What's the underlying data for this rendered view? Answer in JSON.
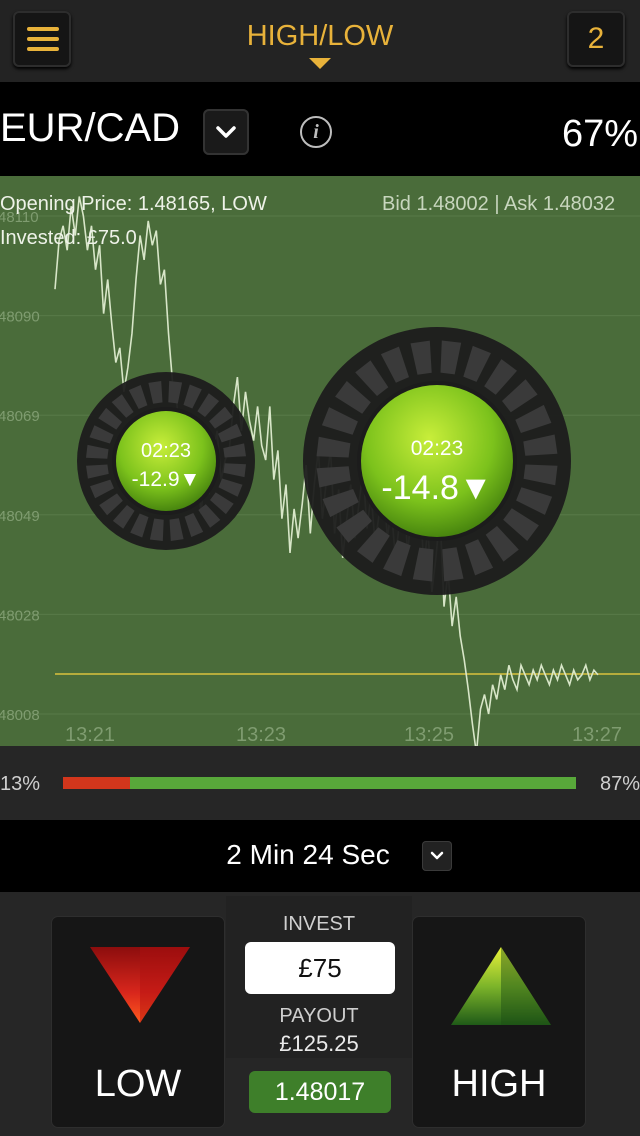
{
  "header": {
    "title": "HIGH/LOW",
    "count": "2"
  },
  "asset": {
    "name": "EUR/CAD",
    "payout_percent": "67%"
  },
  "chart": {
    "opening_price": "Opening Price: 1.48165, LOW",
    "invested": "Invested: £75.0",
    "bid_ask": "Bid 1.48002 | Ask 1.48032",
    "y_ticks": [
      "48110",
      "48090",
      "48069",
      "48049",
      "48028",
      "48008"
    ],
    "x_ticks": [
      "13:21",
      "13:23",
      "13:25",
      "13:27"
    ],
    "timers": [
      {
        "time": "02:23",
        "value": "-12.9▼"
      },
      {
        "time": "02:23",
        "value": "-14.8▼"
      }
    ],
    "colors": {
      "background": "#4a6c3a",
      "line": "#d8e6c8",
      "opening_line": "#d9c23c"
    }
  },
  "chart_data": {
    "type": "line",
    "title": "",
    "xlabel": "",
    "ylabel": "",
    "x_ticks": [
      "13:21",
      "13:23",
      "13:25",
      "13:27"
    ],
    "y_ticks": [
      "48110",
      "48090",
      "48069",
      "48049",
      "48028",
      "48008"
    ],
    "opening_price": 1.48165,
    "series": [
      {
        "x": [
          0,
          0.05,
          0.1,
          0.15,
          0.2,
          0.25,
          0.3,
          0.35,
          0.4,
          0.45,
          0.5,
          0.55,
          0.6,
          0.65,
          0.7,
          0.75,
          0.8,
          0.85,
          0.9,
          0.95,
          1.0,
          1.05,
          1.1,
          1.15,
          1.2,
          1.25,
          1.3,
          1.35,
          1.4,
          1.45,
          1.5,
          1.55,
          1.6,
          1.65,
          1.7,
          1.75,
          1.8,
          1.85,
          1.9,
          1.95,
          2.0,
          2.05,
          2.1,
          2.15,
          2.2,
          2.25,
          2.3,
          2.35,
          2.4,
          2.45,
          2.5,
          2.55,
          2.6,
          2.65,
          2.7,
          2.75,
          2.8,
          2.85,
          2.9,
          2.95,
          3.0,
          3.05,
          3.1,
          3.15,
          3.2,
          3.25,
          3.3,
          3.35,
          3.4,
          3.45,
          3.5,
          3.55,
          3.6,
          3.65,
          3.7,
          3.75,
          3.8,
          3.85,
          3.9,
          3.95,
          4.0,
          4.05,
          4.1,
          4.15,
          4.2,
          4.25,
          4.3,
          4.35,
          4.4,
          4.45,
          4.5,
          4.55,
          4.6,
          4.65,
          4.7,
          4.75,
          4.8,
          4.85,
          4.9,
          4.95,
          5.0,
          5.05,
          5.1,
          5.15,
          5.2,
          5.25,
          5.3,
          5.35,
          5.4,
          5.45,
          5.5,
          5.55,
          5.6,
          5.65,
          5.7,
          5.75,
          5.8,
          5.85,
          5.9,
          5.95,
          6.0,
          6.05,
          6.1,
          6.15,
          6.2,
          6.25,
          6.3,
          6.35,
          6.4,
          6.45,
          6.5,
          6.55,
          6.6,
          6.65,
          6.7
        ],
        "y": [
          1.48095,
          1.48105,
          1.48108,
          1.48103,
          1.48112,
          1.48106,
          1.48114,
          1.4811,
          1.48103,
          1.48108,
          1.48099,
          1.48104,
          1.4809,
          1.48097,
          1.48088,
          1.4808,
          1.48083,
          1.48074,
          1.48079,
          1.48086,
          1.48097,
          1.48106,
          1.48101,
          1.48109,
          1.48104,
          1.48107,
          1.48096,
          1.48099,
          1.48086,
          1.48076,
          1.48072,
          1.48064,
          1.48067,
          1.4806,
          1.48069,
          1.48062,
          1.48049,
          1.48057,
          1.48053,
          1.48061,
          1.48066,
          1.48056,
          1.4806,
          1.48062,
          1.48071,
          1.48077,
          1.48066,
          1.48074,
          1.48068,
          1.48064,
          1.48071,
          1.48063,
          1.4806,
          1.48071,
          1.48056,
          1.48062,
          1.48048,
          1.48055,
          1.48041,
          1.4805,
          1.48044,
          1.48051,
          1.48059,
          1.48045,
          1.48055,
          1.48062,
          1.48048,
          1.48056,
          1.48062,
          1.48045,
          1.48054,
          1.4804,
          1.48048,
          1.48055,
          1.48044,
          1.48051,
          1.48058,
          1.48046,
          1.48053,
          1.48043,
          1.48049,
          1.48057,
          1.48044,
          1.4805,
          1.4804,
          1.48047,
          1.48055,
          1.48041,
          1.48049,
          1.48045,
          1.48054,
          1.48038,
          1.48046,
          1.48033,
          1.4804,
          1.48049,
          1.4803,
          1.48037,
          1.48026,
          1.48032,
          1.48024,
          1.48019,
          1.48013,
          1.48006,
          1.48,
          1.48009,
          1.48012,
          1.48008,
          1.48014,
          1.48011,
          1.48016,
          1.48013,
          1.48018,
          1.48015,
          1.48013,
          1.48018,
          1.48016,
          1.48014,
          1.48017,
          1.48015,
          1.48018,
          1.48016,
          1.48014,
          1.48017,
          1.48015,
          1.48018,
          1.48016,
          1.48014,
          1.48017,
          1.48015,
          1.48016,
          1.48018,
          1.48015,
          1.48017,
          1.48016
        ]
      }
    ]
  },
  "sentiment": {
    "low_percent": "13%",
    "high_percent": "87%",
    "low_fraction": 0.13
  },
  "expiry": {
    "label": "2 Min 24 Sec"
  },
  "trade": {
    "low_label": "LOW",
    "high_label": "HIGH",
    "invest_label": "INVEST",
    "invest_value": "£75",
    "payout_label": "PAYOUT",
    "payout_value": "£125.25",
    "current_price": "1.48017"
  }
}
